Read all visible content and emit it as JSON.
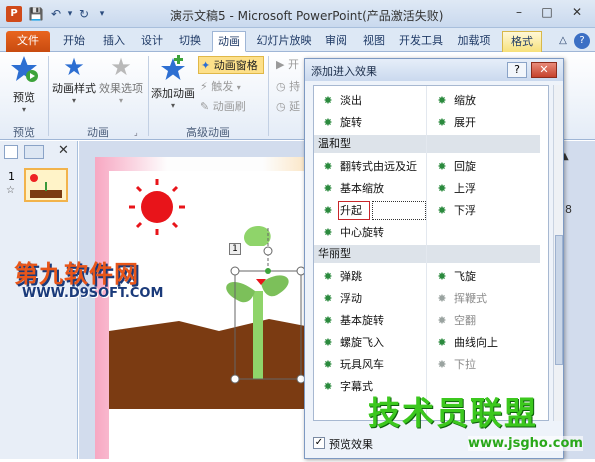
{
  "window": {
    "title": "演示文稿5 - Microsoft PowerPoint(产品激活失败)",
    "app_icon": "P",
    "minimize": "–",
    "maximize": "□",
    "close": "✕"
  },
  "quick_access": {
    "save": "💾",
    "undo": "↶",
    "undo_dropdown": "▾",
    "redo": "↻",
    "customize": "▾"
  },
  "tabs": [
    {
      "label": "文件"
    },
    {
      "label": "开始"
    },
    {
      "label": "插入"
    },
    {
      "label": "设计"
    },
    {
      "label": "切换"
    },
    {
      "label": "动画"
    },
    {
      "label": "幻灯片放映"
    },
    {
      "label": "审阅"
    },
    {
      "label": "视图"
    },
    {
      "label": "开发工具"
    },
    {
      "label": "加载项"
    },
    {
      "label": "格式"
    }
  ],
  "ribbon_right": {
    "collapse": "△",
    "help": "?"
  },
  "ribbon": {
    "preview_label": "预览",
    "preview_group": "预览",
    "anim_style_label": "动画样式",
    "effect_options_label": "效果选项",
    "animation_group": "动画",
    "add_anim_label": "添加动画",
    "anim_pane_label": "动画窗格",
    "trigger_label": "触发",
    "anim_painter_label": "动画刷",
    "advanced_group": "高级动画",
    "start_label": "开",
    "duration_label": "持",
    "delay_label": "延"
  },
  "editor": {
    "slide_number": "1",
    "slide_star": "☆",
    "anim_tag": "1",
    "side_number": "8",
    "pane_scroll_up": "▲"
  },
  "dialog": {
    "title": "添加进入效果",
    "help": "?",
    "close": "✕",
    "effects_top": [
      {
        "label": "淡出"
      },
      {
        "label": "缩放"
      },
      {
        "label": "旋转"
      },
      {
        "label": "展开"
      }
    ],
    "category_moderate": "温和型",
    "effects_moderate": [
      {
        "label": "翻转式由远及近"
      },
      {
        "label": "回旋"
      },
      {
        "label": "基本缩放"
      },
      {
        "label": "上浮"
      },
      {
        "label": "升起"
      },
      {
        "label": "下浮"
      },
      {
        "label": "中心旋转"
      }
    ],
    "category_exciting": "华丽型",
    "effects_exciting": [
      {
        "label": "弹跳"
      },
      {
        "label": "飞旋"
      },
      {
        "label": "浮动"
      },
      {
        "label": "挥鞭式"
      },
      {
        "label": "基本旋转"
      },
      {
        "label": "空翻"
      },
      {
        "label": "螺旋飞入"
      },
      {
        "label": "曲线向上"
      },
      {
        "label": "玩具风车"
      },
      {
        "label": "下拉"
      },
      {
        "label": "字幕式"
      }
    ],
    "preview_checkbox_label": "预览效果",
    "preview_checked": true
  },
  "watermarks": {
    "left_brand": "第九软件网",
    "left_url": "WWW.D9SOFT.COM",
    "right_brand": "技术员联盟",
    "right_url": "www.jsgho.com"
  }
}
